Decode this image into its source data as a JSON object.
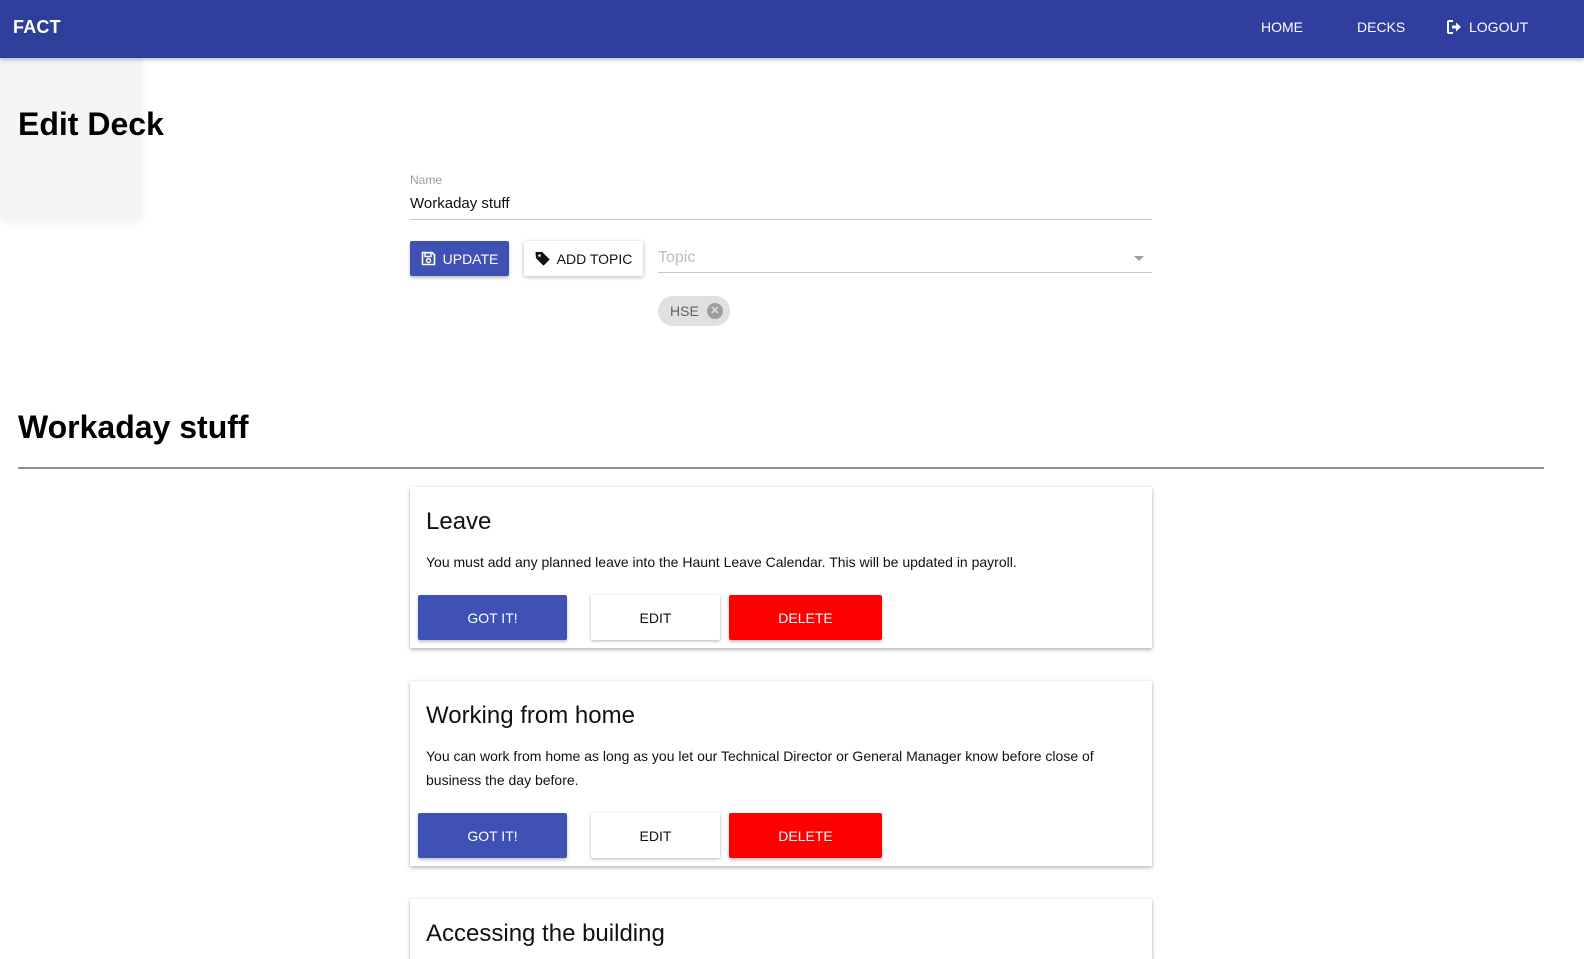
{
  "header": {
    "brand": "FACT",
    "nav": {
      "home": "HOME",
      "decks": "DECKS",
      "logout": "LOGOUT"
    }
  },
  "page": {
    "title": "Edit Deck"
  },
  "form": {
    "name_label": "Name",
    "name_value": "Workaday stuff",
    "update_label": "UPDATE",
    "add_topic_label": "ADD TOPIC",
    "topic_placeholder": "Topic",
    "chips": [
      "HSE"
    ]
  },
  "deck": {
    "title": "Workaday stuff",
    "cards": [
      {
        "title": "Leave",
        "body": "You must add any planned leave into the Haunt Leave Calendar. This will be updated in payroll.",
        "got_it": "GOT IT!",
        "edit": "EDIT",
        "delete": "DELETE"
      },
      {
        "title": "Working from home",
        "body": "You can work from home as long as you let our Technical Director or General Manager know before close of business the day before.",
        "got_it": "GOT IT!",
        "edit": "EDIT",
        "delete": "DELETE"
      },
      {
        "title": "Accessing the building"
      }
    ]
  },
  "colors": {
    "primary": "#3f51b5",
    "appbar": "#303f9f",
    "danger": "#ff0000"
  }
}
